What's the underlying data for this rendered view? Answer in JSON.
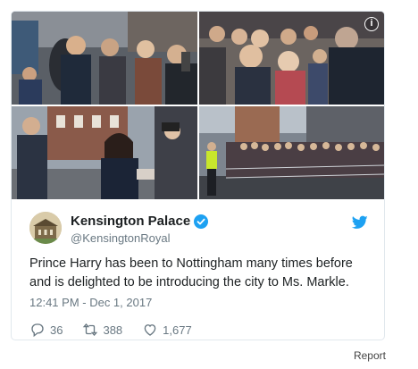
{
  "tweet": {
    "display_name": "Kensington Palace",
    "handle": "@KensingtonRoyal",
    "text": "Prince Harry has been to Nottingham many times before and is delighted to be introducing the city to Ms. Markle.",
    "timestamp": "12:41 PM - Dec 1, 2017",
    "replies": "36",
    "retweets": "388",
    "likes": "1,677",
    "verified": true
  },
  "media": {
    "photo_count": 4,
    "info_icon": "info-icon"
  },
  "footer": {
    "report_label": "Report"
  },
  "colors": {
    "brand_blue": "#1da1f2",
    "text": "#1c2022",
    "muted": "#697882",
    "border": "#e1e8ed"
  }
}
